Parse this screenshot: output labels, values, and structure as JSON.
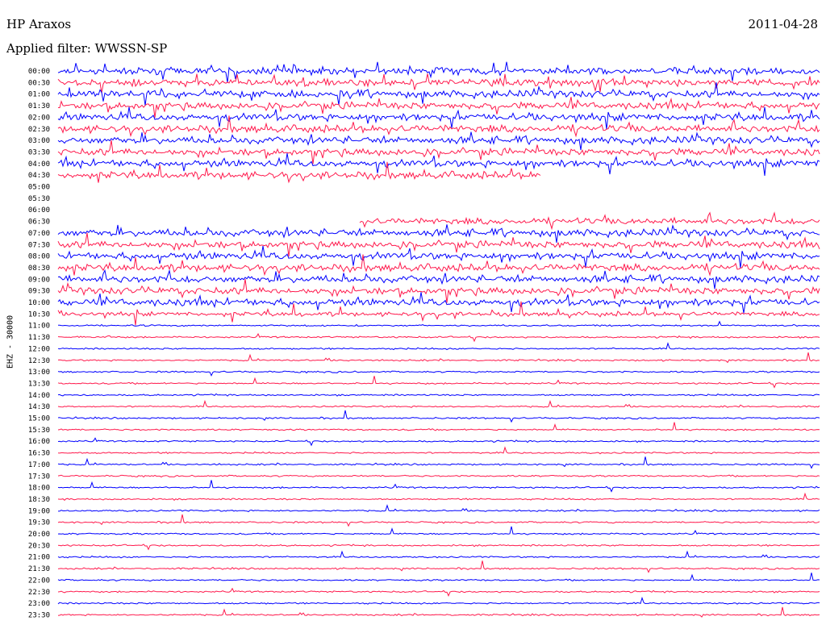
{
  "header": {
    "station": "HP Araxos",
    "date": "2011-04-28",
    "filter": "Applied filter: WWSSN-SP"
  },
  "chart_data": {
    "type": "line",
    "ylabel": "EHZ - 30000",
    "row_labels": [
      "00:00",
      "00:30",
      "01:00",
      "01:30",
      "02:00",
      "02:30",
      "03:00",
      "03:30",
      "04:00",
      "04:30",
      "05:00",
      "05:30",
      "06:00",
      "06:30",
      "07:00",
      "07:30",
      "08:00",
      "08:30",
      "09:00",
      "09:30",
      "10:00",
      "10:30",
      "11:00",
      "11:30",
      "12:00",
      "12:30",
      "13:00",
      "13:30",
      "14:00",
      "14:30",
      "15:00",
      "15:30",
      "16:00",
      "16:30",
      "17:00",
      "17:30",
      "18:00",
      "18:30",
      "19:00",
      "19:30",
      "20:00",
      "20:30",
      "21:00",
      "21:30",
      "22:00",
      "22:30",
      "23:00",
      "23:30"
    ],
    "series_colors": [
      "#0000ff",
      "#ff1a4d"
    ],
    "rows_per_hour": 2,
    "grid": false,
    "legend": "none"
  }
}
